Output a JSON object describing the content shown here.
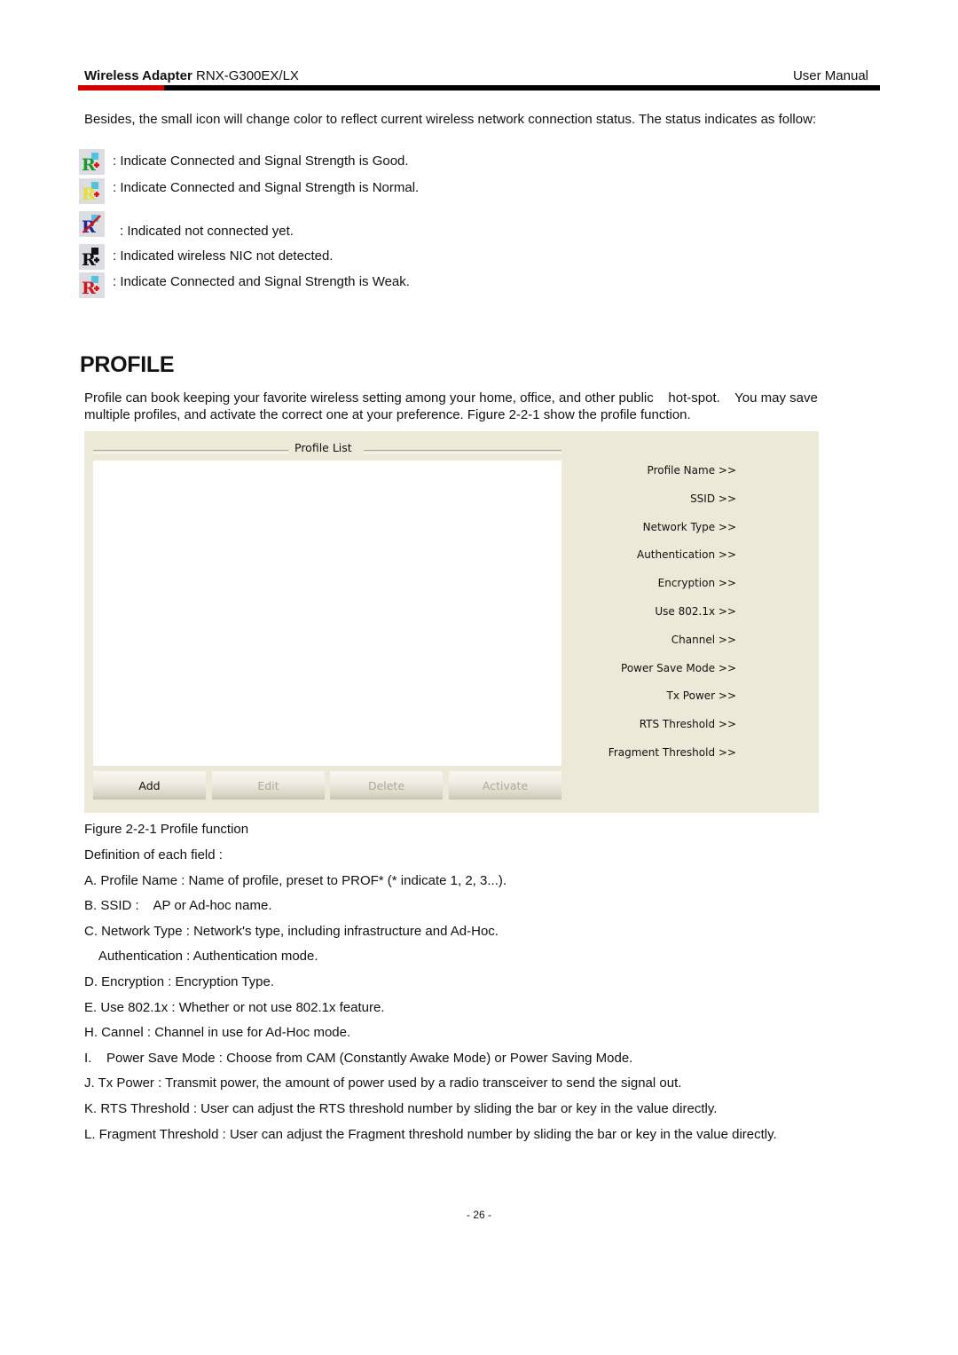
{
  "header": {
    "product_bold": "Wireless Adapter",
    "model": "RNX-G300EX/LX",
    "doc_type": "User Manual",
    "accent_color": "#d40000"
  },
  "intro": "Besides, the small icon will change color to reflect current wireless network connection status. The status indicates as follow:",
  "status_icons": [
    {
      "icon": "tray-icon-good-green",
      "text": ": Indicate Connected and Signal Strength is Good."
    },
    {
      "icon": "tray-icon-normal-yellow",
      "text": ": Indicate Connected and Signal Strength is Normal."
    },
    {
      "icon": "tray-icon-not-connected-red-x",
      "text": ": Indicated not connected yet."
    },
    {
      "icon": "tray-icon-nic-not-detected-black",
      "text": ": Indicated wireless NIC not detected."
    },
    {
      "icon": "tray-icon-weak-red",
      "text": ": Indicate Connected and Signal Strength is Weak."
    }
  ],
  "section_title": "PROFILE",
  "section_desc": "Profile can book keeping your favorite wireless setting among your home, office, and other public    hot-spot.    You may save multiple profiles, and activate the correct one at your preference. Figure 2-2-1 show the profile function.",
  "panel": {
    "group_title": "Profile List",
    "fields": [
      "Profile Name >>",
      "SSID >>",
      "Network Type >>",
      "Authentication >>",
      "Encryption >>",
      "Use 802.1x >>",
      "Channel >>",
      "Power Save Mode >>",
      "Tx Power >>",
      "RTS Threshold >>",
      "Fragment Threshold >>"
    ],
    "buttons": {
      "add": "Add",
      "edit": "Edit",
      "delete": "Delete",
      "activate": "Activate"
    }
  },
  "figure_caption": "Figure 2-2-1 Profile function",
  "definitions_heading": "Definition of each field :",
  "definitions": [
    "A. Profile Name : Name of profile, preset to PROF* (* indicate 1, 2, 3...).",
    "B. SSID :    AP or Ad-hoc name.",
    "C. Network Type : Network's type, including infrastructure and Ad-Hoc.",
    "    Authentication : Authentication mode.",
    "D. Encryption : Encryption Type.",
    "E. Use 802.1x : Whether or not use 802.1x feature.",
    "H. Cannel : Channel in use for Ad-Hoc mode.",
    "I.    Power Save Mode : Choose from CAM (Constantly Awake Mode) or Power Saving Mode.",
    "J. Tx Power : Transmit power, the amount of power used by a radio transceiver to send the signal out.",
    "K. RTS Threshold : User can adjust the RTS threshold number by sliding the bar or key in the value directly.",
    "L. Fragment Threshold : User can adjust the Fragment threshold number by sliding the bar or key in the value directly."
  ],
  "page_number": "- 26 -"
}
